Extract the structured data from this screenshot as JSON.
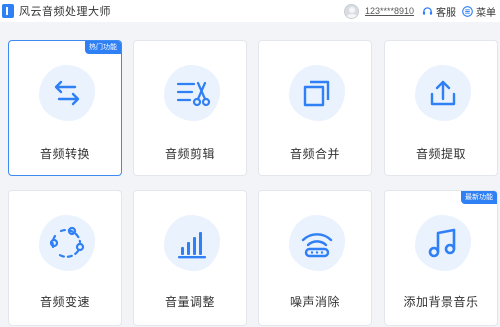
{
  "app": {
    "title": "风云音频处理大师"
  },
  "header": {
    "account": "123****8910",
    "service_label": "客服",
    "menu_label": "菜单"
  },
  "accent_color": "#2f7ff5",
  "tools": [
    {
      "label": "音频转换",
      "icon": "convert-arrows-icon",
      "badge": "热门功能",
      "selected": true
    },
    {
      "label": "音频剪辑",
      "icon": "scissors-icon"
    },
    {
      "label": "音频合并",
      "icon": "merge-squares-icon"
    },
    {
      "label": "音频提取",
      "icon": "upload-tray-icon"
    },
    {
      "label": "音频变速",
      "icon": "speed-dots-icon"
    },
    {
      "label": "音量调整",
      "icon": "volume-bars-icon"
    },
    {
      "label": "噪声消除",
      "icon": "noise-wifi-icon"
    },
    {
      "label": "添加背景音乐",
      "icon": "music-note-icon",
      "badge": "最新功能"
    }
  ]
}
